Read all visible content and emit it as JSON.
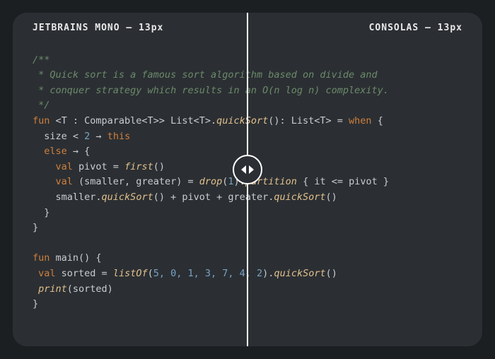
{
  "header": {
    "left_label": "JETBRAINS MONO – 13px",
    "right_label": "CONSOLAS – 13px"
  },
  "code": {
    "doc1": "/**",
    "doc2": " * Quick sort is a famous sort algorithm based on divide and",
    "doc3": " * conquer strategy which results in an O(n log n) complexity.",
    "doc4": " */",
    "l1": {
      "kw": "fun",
      "gen": " <T : Comparable<T>> List<T>.",
      "fn": "quickSort",
      "sig": "(): List<T> = ",
      "when": "when",
      " brace": " {"
    },
    "l2": {
      "a": "  size < ",
      "n": "2",
      "arr": " → ",
      "th": "this"
    },
    "l3": {
      "a": "  ",
      "else": "else",
      "arr": " → {"
    },
    "l4": {
      "a": "    ",
      "val": "val",
      "b": " pivot = ",
      "fn": "first",
      "c": "()"
    },
    "l5": {
      "a": "    ",
      "val": "val",
      "b": " (smaller, greater) = ",
      "fn1": "drop",
      "c": "(",
      "n": "1",
      "d": ").",
      "fn2": "partition",
      "e": " { it <= pivot }"
    },
    "l6": {
      "a": "    smaller.",
      "fn1": "quickSort",
      "b": "() + pivot + greater.",
      "fn2": "quickSort",
      "c": "()"
    },
    "l7": "  }",
    "l8": "}",
    "l9": "",
    "m1": {
      "kw": "fun",
      "a": " main() {"
    },
    "m2": {
      "a": " ",
      "val": "val",
      "b": " sorted = ",
      "fn": "listOf",
      "c": "(",
      "nums": "5, 0, 1, 3, 7, 4, 2",
      "d": ").",
      "fn2": "quickSort",
      "e": "()"
    },
    "m3": {
      "a": " ",
      "fn": "print",
      "b": "(sorted)"
    },
    "m4": "}"
  },
  "slider": {
    "icon": "compare-handle"
  }
}
